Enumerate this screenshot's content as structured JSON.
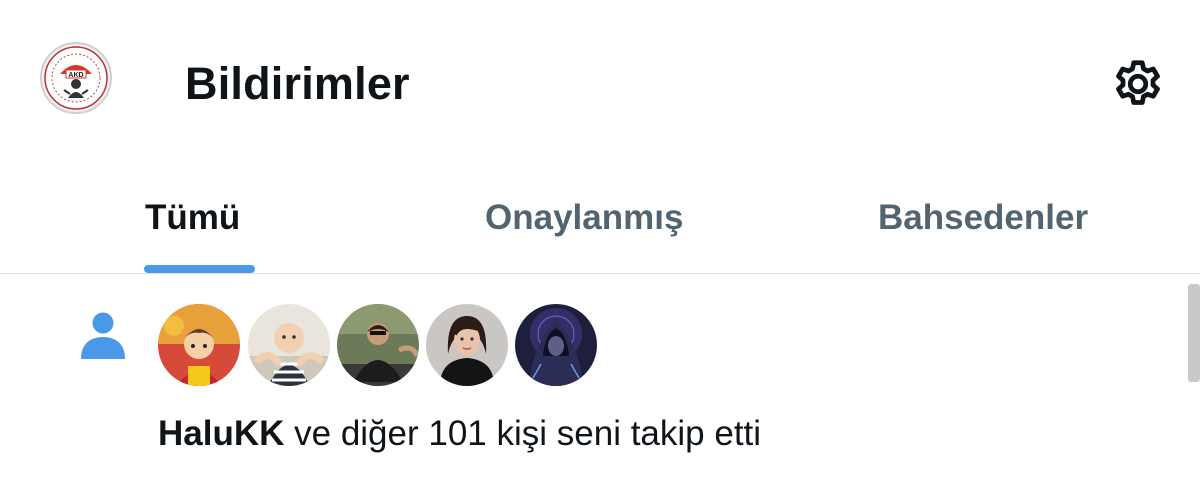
{
  "header": {
    "title": "Bildirimler",
    "avatar_badge_text": "AKD",
    "settings_icon": "gear-icon"
  },
  "tabs": [
    {
      "label": "Tümü",
      "active": true
    },
    {
      "label": "Onaylanmış",
      "active": false
    },
    {
      "label": "Bahsedenler",
      "active": false
    }
  ],
  "notification": {
    "icon": "person-icon",
    "actor": "HaluKK",
    "text": " ve diğer 101 kişi seni takip etti",
    "avatars": [
      "avatar-1",
      "avatar-2",
      "avatar-3",
      "avatar-4",
      "avatar-5"
    ]
  },
  "colors": {
    "accent": "#4a99e9",
    "text_primary": "#0f1419",
    "text_secondary": "#536471",
    "divider": "#dfe3e6"
  }
}
